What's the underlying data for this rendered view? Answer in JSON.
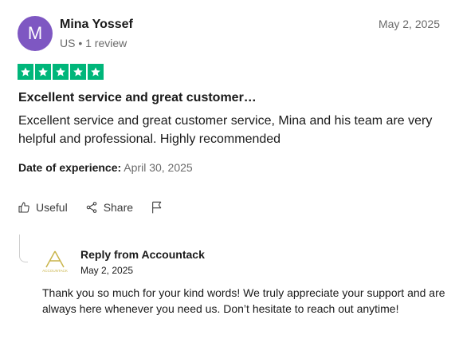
{
  "reviewer": {
    "initial": "M",
    "name": "Mina Yossef",
    "meta": "US • 1 review",
    "avatar_color": "#7e57c2"
  },
  "review": {
    "date": "May 2, 2025",
    "rating": 5,
    "rating_max": 5,
    "star_color": "#00b67a",
    "title": "Excellent service and great customer…",
    "text": "Excellent service and great customer service, Mina and his team are very helpful and professional. Highly recommended",
    "date_of_experience_label": "Date of experience:",
    "date_of_experience_value": "April 30, 2025"
  },
  "actions": {
    "useful_label": "Useful",
    "useful_icon": "thumbs-up-icon",
    "share_label": "Share",
    "share_icon": "share-icon",
    "flag_icon": "flag-icon"
  },
  "reply": {
    "title": "Reply from Accountack",
    "date": "May 2, 2025",
    "text": "Thank you so much for your kind words! We truly appreciate your support and are always here whenever you need us. Don’t hesitate to reach out anytime!",
    "logo_text": "ACCOUNTACK",
    "logo_color": "#c9b44a"
  }
}
